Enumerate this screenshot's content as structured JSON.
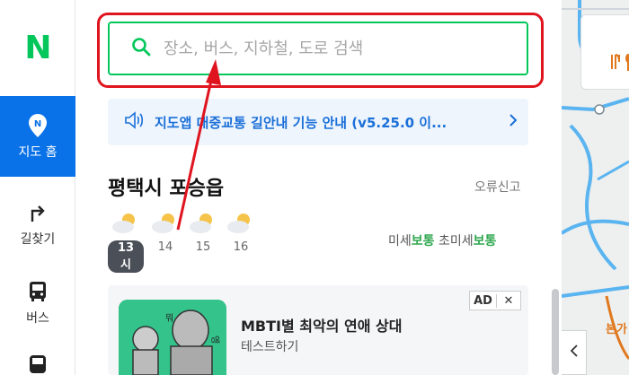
{
  "rail": {
    "logo": "N",
    "items": [
      {
        "label": "지도 홈",
        "icon": "map-pin-icon",
        "active": true
      },
      {
        "label": "길찾기",
        "icon": "turn-right-icon"
      },
      {
        "label": "버스",
        "icon": "bus-icon"
      },
      {
        "label": "",
        "icon": "subway-icon"
      }
    ]
  },
  "search": {
    "placeholder": "장소, 버스, 지하철, 도로 검색"
  },
  "notice": {
    "text": "지도앱 대중교통 길안내 기능 안내 (v5.25.0 이..."
  },
  "place": {
    "title": "평택시 포승읍",
    "report": "오류신고"
  },
  "weather": {
    "hours": [
      {
        "hour": "13시",
        "now": true
      },
      {
        "hour": "14"
      },
      {
        "hour": "15"
      },
      {
        "hour": "16"
      }
    ]
  },
  "dust": {
    "fine_label": "미세",
    "fine_value": "보통",
    "ultra_label": "초미세",
    "ultra_value": "보통"
  },
  "ad": {
    "badge": "AD",
    "close": "✕",
    "title": "MBTI별 최악의 연애 상대",
    "subtitle": "테스트하기",
    "thumb_text_1": "뭐",
    "thumb_text_2": "엥"
  },
  "map": {
    "label": "본가"
  },
  "colors": {
    "accent_green": "#03c75a",
    "rail_active": "#0a72e8",
    "highlight": "#e0141e",
    "notice_blue": "#1a6fd8",
    "good": "#2fa84f"
  }
}
